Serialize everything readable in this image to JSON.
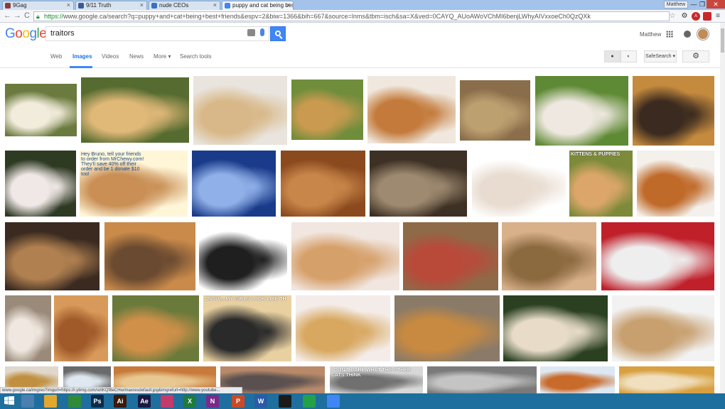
{
  "browser": {
    "tabs": [
      {
        "label": "9Gag",
        "fav": "#8b3b3b"
      },
      {
        "label": "9/11 Truth",
        "fav": "#3b5998"
      },
      {
        "label": "nude CEOs",
        "fav": "#3a6fc4"
      },
      {
        "label": "puppy and cat being best",
        "fav": "#4285f4"
      }
    ],
    "user_badge": "Matthew",
    "url_scheme": "https://",
    "url_rest": "www.google.ca/search?q=puppy+and+cat+being+best+friends&espv=2&biw=1366&bih=667&source=lnms&tbm=isch&sa=X&ved=0CAYQ_AUoAWoVChMI6benjLWhyAIVxxoeCh0QzQXk",
    "window_controls": {
      "minimize": "—",
      "maximize": "❐",
      "close": "✕"
    },
    "nav": {
      "back": "←",
      "forward": "→",
      "reload": "C"
    }
  },
  "google": {
    "logo_letters": [
      {
        "ch": "G",
        "color": "#4285f4"
      },
      {
        "ch": "o",
        "color": "#ea4335"
      },
      {
        "ch": "o",
        "color": "#fbbc05"
      },
      {
        "ch": "g",
        "color": "#4285f4"
      },
      {
        "ch": "l",
        "color": "#34a853"
      },
      {
        "ch": "e",
        "color": "#ea4335"
      }
    ],
    "query": "traitors",
    "account_name": "Matthew"
  },
  "toolbar": {
    "web": "Web",
    "images": "Images",
    "videos": "Videos",
    "news": "News",
    "more": "More ▾",
    "search_tools": "Search tools",
    "safesearch": "SafeSearch ▾"
  },
  "grid_rows": [
    [
      {
        "c1": "#6b7a3e",
        "c2": "#f2ecdc"
      },
      {
        "c1": "#556b2f",
        "c2": "#e0b878"
      },
      {
        "c1": "#e9e4dd",
        "c2": "#d8b888"
      },
      {
        "c1": "#6f8d3b",
        "c2": "#c99a4f"
      },
      {
        "c1": "#f0e8de",
        "c2": "#c37a3a"
      },
      {
        "c1": "#8a6d4a",
        "c2": "#bda070"
      },
      {
        "c1": "#5f8a35",
        "c2": "#efe8e0"
      },
      {
        "c1": "#c48a3e",
        "c2": "#3a2a1f"
      }
    ],
    [
      {
        "c1": "#2f3a23",
        "c2": "#f0e8e6"
      },
      {
        "c1": "#fff6d8",
        "c2": "#c98f55",
        "text": "Hey Bruno, tell your friends to order from MrChewy.com! They'll save 40% off their order and be 1 donate $10 too!"
      },
      {
        "c1": "#1a3b8a",
        "c2": "#8fb0e8"
      },
      {
        "c1": "#8a4a1e",
        "c2": "#c9864a"
      },
      {
        "c1": "#3d3024",
        "c2": "#9e8a70"
      },
      {
        "c1": "#ffffff",
        "c2": "#e8dcd0"
      },
      {
        "c1": "#7d8a3a",
        "c2": "#dca66a",
        "text": "KITTENS & PUPPIES"
      },
      {
        "c1": "#f4f1ec",
        "c2": "#c06a2a"
      }
    ],
    [
      {
        "c1": "#3a2a20",
        "c2": "#b08050"
      },
      {
        "c1": "#c98a4a",
        "c2": "#6a4a30"
      },
      {
        "c1": "#ffffff",
        "c2": "#1f1f1f"
      },
      {
        "c1": "#f1e6e0",
        "c2": "#d6a06a"
      },
      {
        "c1": "#8e6a48",
        "c2": "#b94a3a"
      },
      {
        "c1": "#d8b08a",
        "c2": "#8c6a40"
      },
      {
        "c1": "#c0202a",
        "c2": "#eeeeee"
      }
    ],
    [
      {
        "c1": "#9a8a7a",
        "c2": "#f0e8e0"
      },
      {
        "c1": "#d89a5a",
        "c2": "#a05a2a"
      },
      {
        "c1": "#6a7a3a",
        "c2": "#d0904a"
      },
      {
        "c1": "#e8d0a0",
        "c2": "#2a2a2a",
        "text": "DNOW... MY GIRLS LOOK LIKE TH"
      },
      {
        "c1": "#f4ece8",
        "c2": "#d8a860"
      },
      {
        "c1": "#8a7a68",
        "c2": "#c88a40"
      },
      {
        "c1": "#2a4020",
        "c2": "#e8dcc8"
      },
      {
        "c1": "#f2f2f2",
        "c2": "#c8a070"
      }
    ],
    [
      {
        "c1": "#e0d8cc",
        "c2": "#c09040"
      },
      {
        "c1": "#6a6a6a",
        "c2": "#dfe8f0"
      },
      {
        "c1": "#c87a3a",
        "c2": "#e8c890"
      },
      {
        "c1": "#b88a6a",
        "c2": "#5a5050"
      },
      {
        "c1": "#d8d8d8",
        "c2": "#707070",
        "text": "I DON'T CARE WHAT THE OTHER CATS THINK"
      },
      {
        "c1": "#7a7a7a",
        "c2": "#c4c4c4"
      },
      {
        "c1": "#dde8f2",
        "c2": "#c86a2a"
      },
      {
        "c1": "#d8a040",
        "c2": "#f0e0c0"
      }
    ]
  ],
  "status_url": "www.google.ca/imgres?imgurl=https://i.ytimg.com/vi/tKQf8eCHw/maxresdefault.jpg&imgrefurl=http://www.youtube...",
  "taskbar_apps": [
    {
      "label": "",
      "bg": "#4a7fb0"
    },
    {
      "label": "",
      "bg": "#e2a72f"
    },
    {
      "label": "",
      "bg": "#2f8a3a"
    },
    {
      "label": "Ps",
      "bg": "#0c2c4a"
    },
    {
      "label": "Ai",
      "bg": "#3a1a0a"
    },
    {
      "label": "Ae",
      "bg": "#1a1a40"
    },
    {
      "label": "",
      "bg": "#c43a6a"
    },
    {
      "label": "X",
      "bg": "#1e7a3e"
    },
    {
      "label": "N",
      "bg": "#7a2a8a"
    },
    {
      "label": "P",
      "bg": "#c84a28"
    },
    {
      "label": "W",
      "bg": "#2a5aa8"
    },
    {
      "label": "",
      "bg": "#1a1a1a"
    },
    {
      "label": "",
      "bg": "#24a04a"
    },
    {
      "label": "",
      "bg": "#4285f4"
    }
  ]
}
